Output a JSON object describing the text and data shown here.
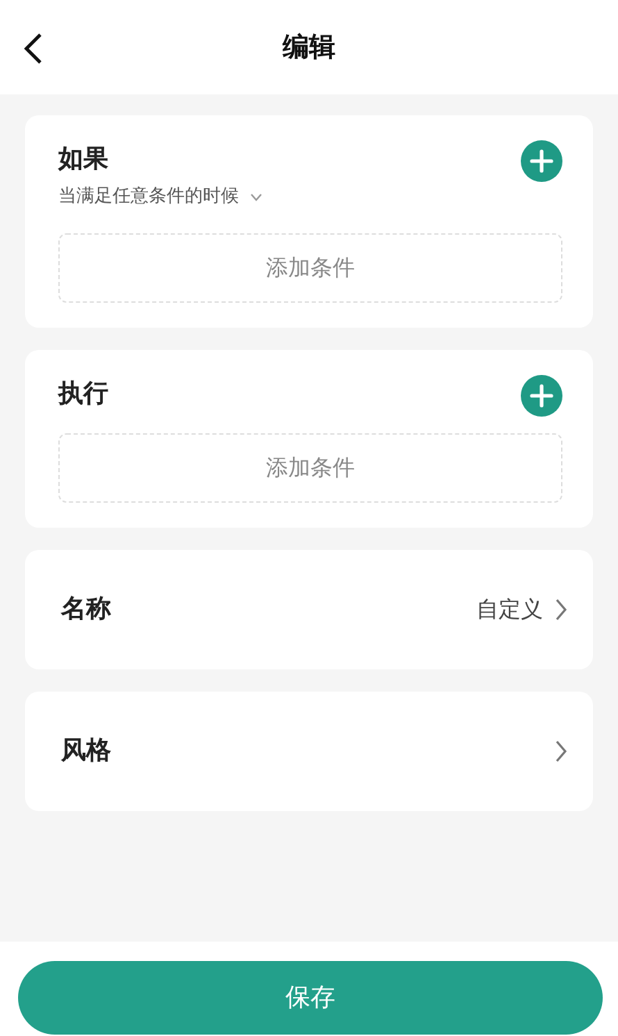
{
  "header": {
    "title": "编辑"
  },
  "sections": [
    {
      "kind": "conditions",
      "title": "如果",
      "subtitle": "当满足任意条件的时候",
      "slot": "添加条件"
    },
    {
      "kind": "conditions",
      "title": "执行",
      "slot": "添加条件"
    },
    {
      "kind": "setting",
      "title": "名称",
      "value": "自定义"
    },
    {
      "kind": "setting",
      "title": "风格"
    }
  ],
  "save_button": "保存"
}
